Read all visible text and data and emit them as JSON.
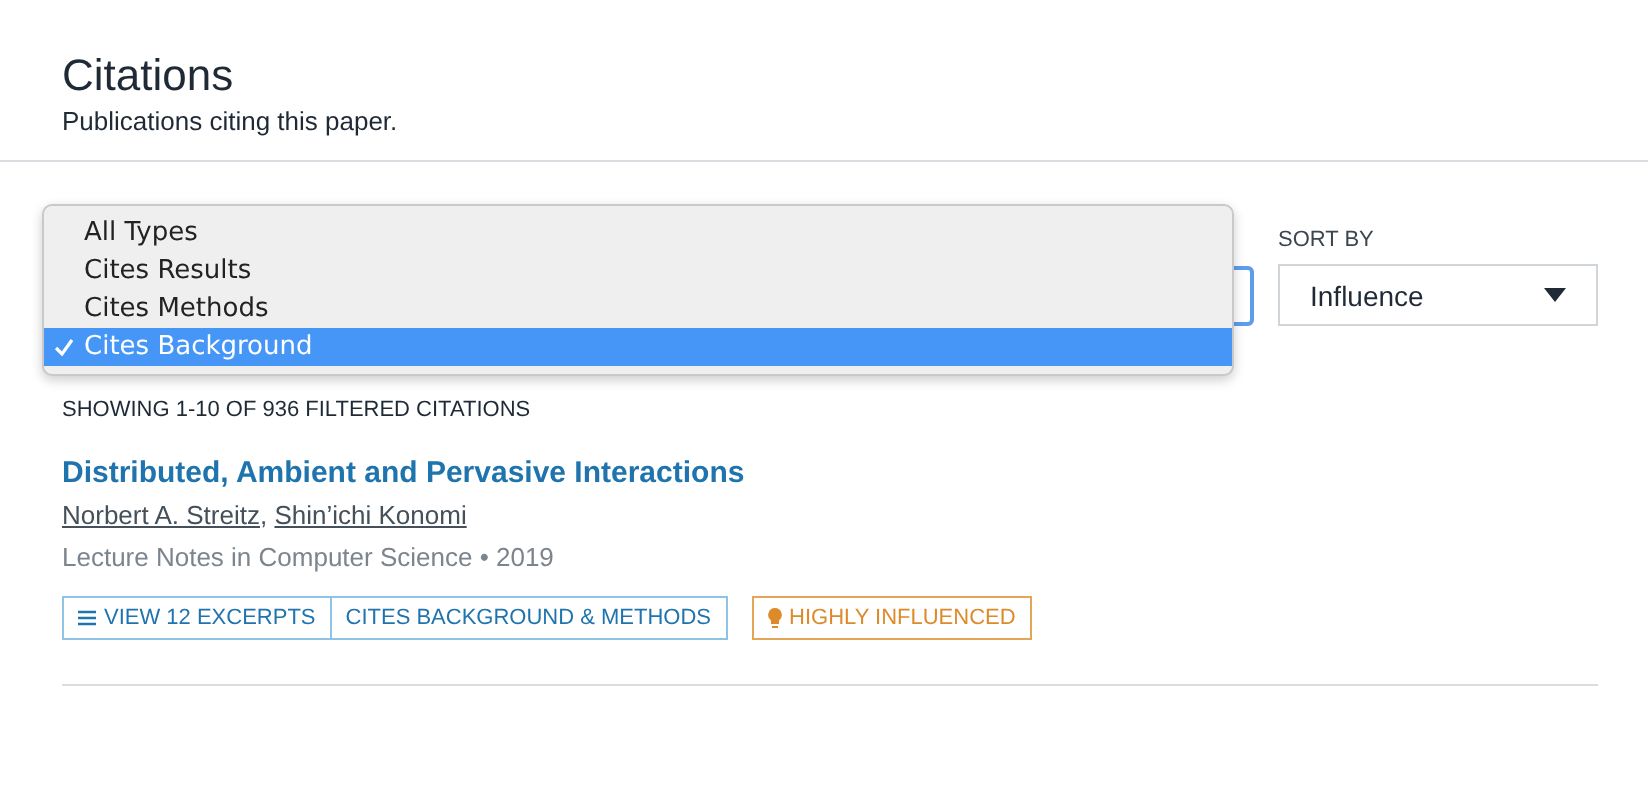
{
  "header": {
    "title": "Citations",
    "subtitle": "Publications citing this paper."
  },
  "filter_menu": {
    "items": [
      {
        "label": "All Types",
        "selected": false
      },
      {
        "label": "Cites Results",
        "selected": false
      },
      {
        "label": "Cites Methods",
        "selected": false
      },
      {
        "label": "Cites Background",
        "selected": true
      }
    ]
  },
  "sort": {
    "label": "SORT BY",
    "value": "Influence"
  },
  "results_count": "SHOWING 1-10 OF 936 FILTERED CITATIONS",
  "citations": [
    {
      "title": "Distributed, Ambient and Pervasive Interactions",
      "authors": [
        "Norbert A. Streitz",
        "Shin’ichi Konomi"
      ],
      "author_separator": ",",
      "venue": "Lecture Notes in Computer Science • 2019",
      "excerpts_button": "VIEW 12 EXCERPTS",
      "intent": "CITES BACKGROUND & METHODS",
      "badge": "HIGHLY INFLUENCED"
    }
  ]
}
